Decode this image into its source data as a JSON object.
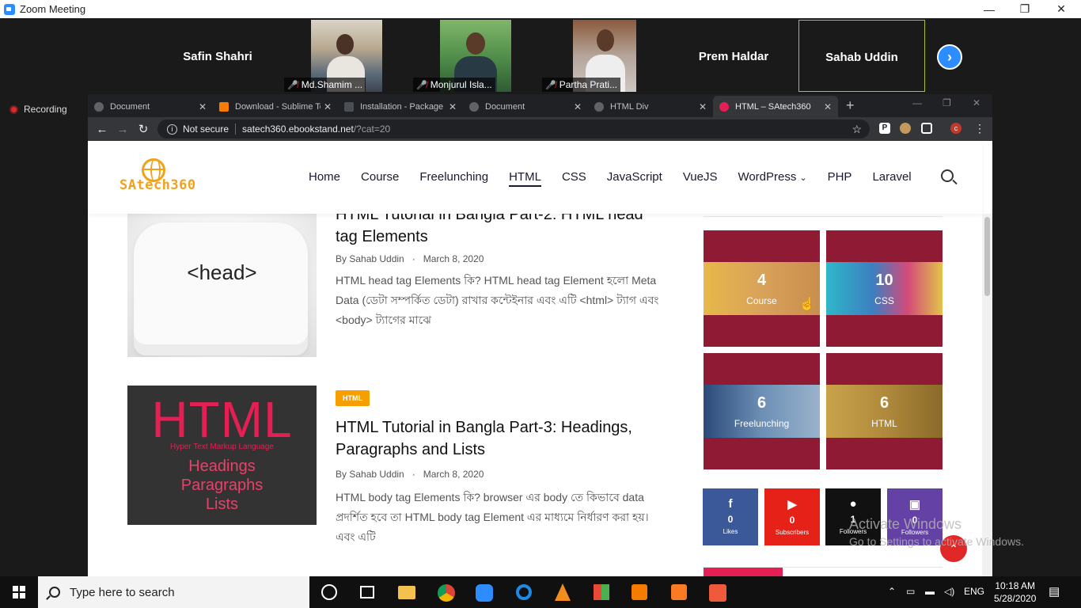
{
  "zoom": {
    "title": "Zoom Meeting",
    "recording": "Recording",
    "participants": [
      {
        "name": "Safin Shahri"
      },
      {
        "name": "Md.Shamim ..."
      },
      {
        "name": "Monjurul Isla..."
      },
      {
        "name": "Partha Prati..."
      },
      {
        "name": "Prem Haldar"
      },
      {
        "name": "Sahab Uddin"
      }
    ]
  },
  "chrome": {
    "tabs": [
      {
        "title": "Document"
      },
      {
        "title": "Download - Sublime Te"
      },
      {
        "title": "Installation - Package C"
      },
      {
        "title": "Document"
      },
      {
        "title": "HTML Div"
      },
      {
        "title": "HTML – SAtech360"
      }
    ],
    "security": "Not secure",
    "url_host": "satech360.ebookstand.net",
    "url_path": "/?cat=20",
    "profile_initial": "c"
  },
  "site": {
    "logo": "SAtech360",
    "nav": [
      "Home",
      "Course",
      "Freelunching",
      "HTML",
      "CSS",
      "JavaScript",
      "VueJS",
      "WordPress",
      "PHP",
      "Laravel"
    ],
    "posts": [
      {
        "image_text": "<head>",
        "title": "HTML Tutorial in Bangla Part-2: HTML head tag Elements",
        "author": "By Sahab Uddin",
        "date": "March 8, 2020",
        "excerpt": "HTML head tag Elements কি? HTML head tag Element হলো Meta Data (ডেটা সম্পর্কিত ডেটা) রাখার কন্টেইনার এবং এটি <html> ট্যাগ এবং <body> ট্যাগের মাঝে"
      },
      {
        "badge": "HTML",
        "image_big": "HTML",
        "image_sub": "Hyper Text Markup Language",
        "image_lines": [
          "Headings",
          "Paragraphs",
          "Lists"
        ],
        "title": "HTML Tutorial in Bangla Part-3: Headings, Paragraphs and Lists",
        "author": "By Sahab Uddin",
        "date": "March 8, 2020",
        "excerpt": "HTML body tag Elements কি? browser এর body তে কিভাবে data প্রদর্শিত হবে তা HTML body tag Element এর মাধ্যমে নির্ধারণ করা হয়। এবং এটি"
      }
    ],
    "categories": [
      {
        "count": "4",
        "name": "Course"
      },
      {
        "count": "10",
        "name": "CSS"
      },
      {
        "count": "6",
        "name": "Freelunching"
      },
      {
        "count": "6",
        "name": "HTML"
      }
    ],
    "social": [
      {
        "icon": "f",
        "count": "0",
        "label": "Likes",
        "color": "#3b5998"
      },
      {
        "icon": "▶",
        "count": "0",
        "label": "Subscribers",
        "color": "#e62117"
      },
      {
        "icon": "●",
        "count": "1",
        "label": "Followers",
        "color": "#111111"
      },
      {
        "icon": "▣",
        "count": "0",
        "label": "Followers",
        "color": "#6441a5"
      }
    ]
  },
  "watermark": {
    "line1": "Activate Windows",
    "line2": "Go to Settings to activate Windows."
  },
  "taskbar": {
    "search_placeholder": "Type here to search",
    "lang": "ENG",
    "time": "10:18 AM",
    "date": "5/28/2020"
  }
}
